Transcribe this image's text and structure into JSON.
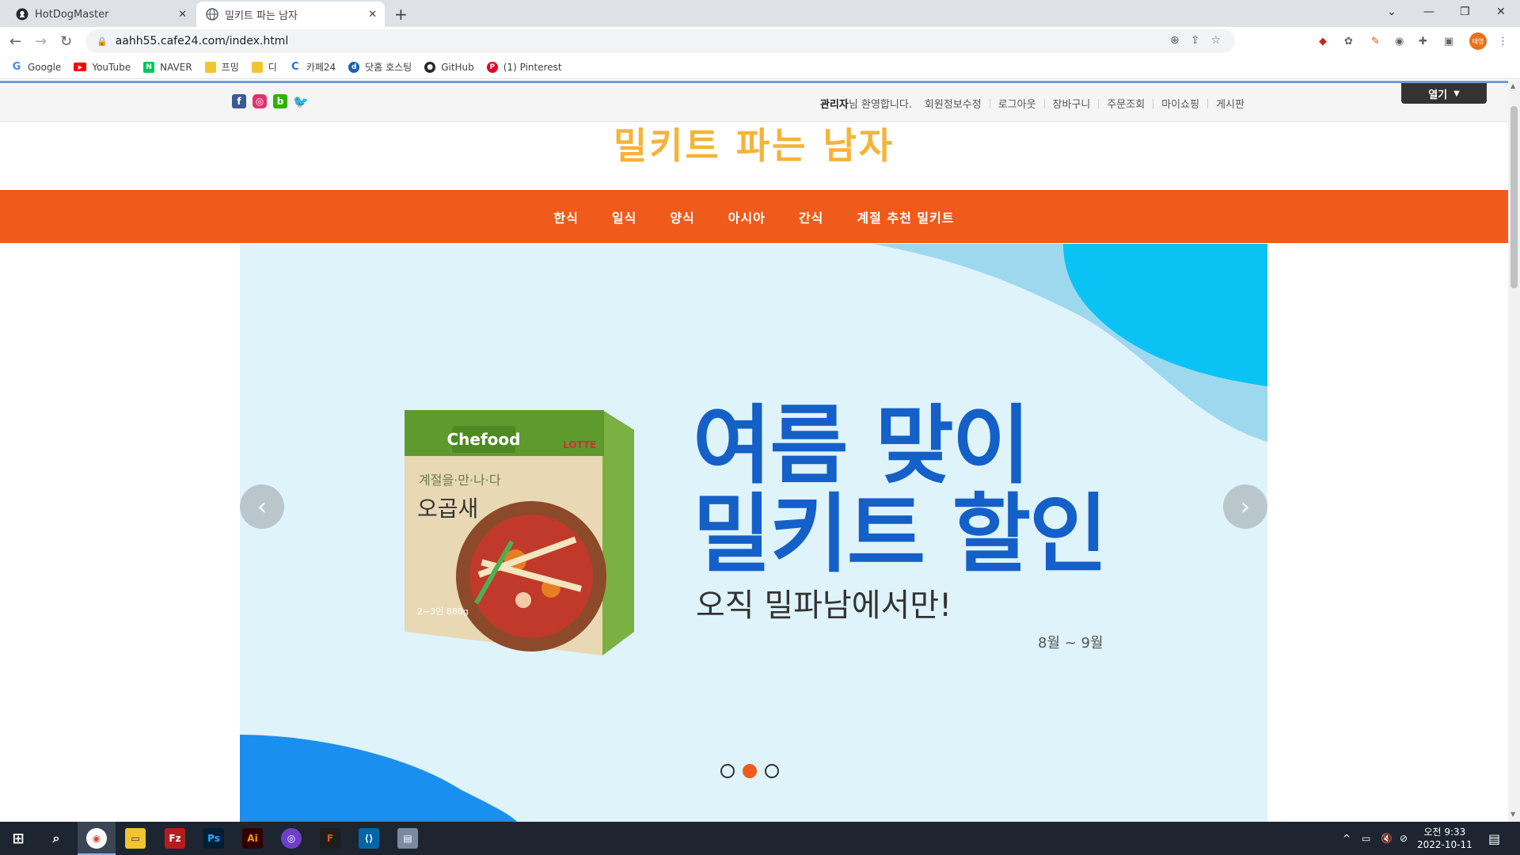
{
  "browser": {
    "tabs": [
      {
        "title": "HotDogMaster",
        "icon": "github-icon"
      },
      {
        "title": "밀키트 파는 남자",
        "icon": "globe-icon"
      }
    ],
    "url": "aahh55.cafe24.com/index.html",
    "bookmarks": [
      {
        "label": "Google",
        "icon": "google-icon",
        "color": "#4285f4"
      },
      {
        "label": "YouTube",
        "icon": "youtube-icon",
        "color": "#ff0000"
      },
      {
        "label": "NAVER",
        "icon": "naver-icon",
        "color": "#03c75a"
      },
      {
        "label": "프밍",
        "icon": "folder-icon",
        "color": "#f4c430"
      },
      {
        "label": "디",
        "icon": "folder-icon",
        "color": "#f4c430"
      },
      {
        "label": "카페24",
        "icon": "cafe24-icon",
        "color": "#1a73e8"
      },
      {
        "label": "닷홈 호스팅",
        "icon": "dothome-icon",
        "color": "#1a5fb4"
      },
      {
        "label": "GitHub",
        "icon": "github-icon",
        "color": "#24292e"
      },
      {
        "label": "(1) Pinterest",
        "icon": "pinterest-icon",
        "color": "#e60023"
      }
    ],
    "avatar_text": "태영"
  },
  "page": {
    "user_menu": {
      "admin": "관리자",
      "welcome": "님 환영합니다.",
      "links": [
        "회원정보수정",
        "로그아웃",
        "장바구니",
        "주문조회",
        "마이쇼핑",
        "게시판"
      ]
    },
    "open_button": "열기",
    "logo": "밀키트 파는 남자",
    "gnb": [
      "한식",
      "일식",
      "양식",
      "아시아",
      "간식",
      "계절 추천 밀키트"
    ],
    "banner": {
      "headline_line1": "여름 맞이",
      "headline_line2": "밀키트 할인",
      "sub": "오직 밀파남에서만!",
      "period": "8월 ~ 9월",
      "product": {
        "brand": "Chefood",
        "maker": "LOTTE",
        "tagline": "계절을·만·나·다",
        "name": "오곱새",
        "weight": "2~3인 880g"
      },
      "active_slide": 2,
      "slide_count": 3
    }
  },
  "taskbar": {
    "time": "오전 9:33",
    "date": "2022-10-11"
  }
}
